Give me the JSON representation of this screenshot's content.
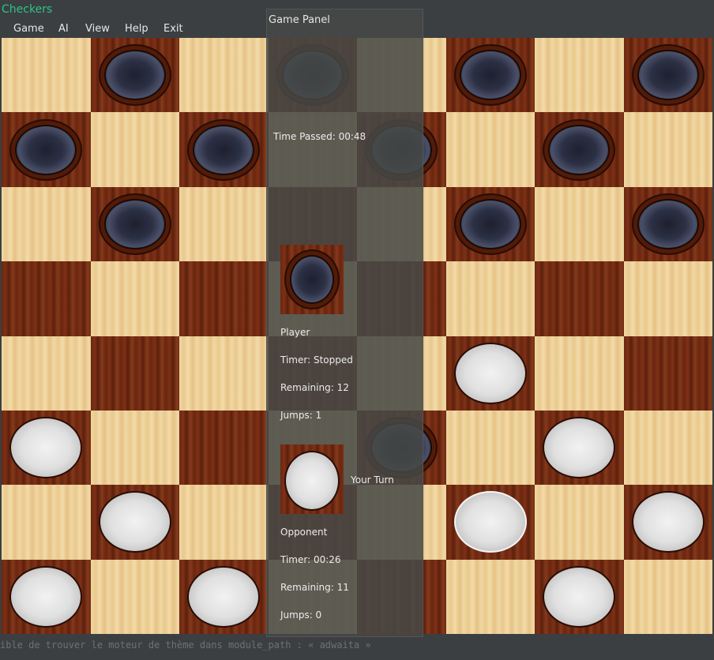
{
  "app": {
    "title": "Checkers"
  },
  "menu": [
    "Game",
    "AI",
    "View",
    "Help",
    "Exit"
  ],
  "board": {
    "rows": 8,
    "cols": 8,
    "pieces": [
      {
        "row": 0,
        "col": 1,
        "color": "black"
      },
      {
        "row": 0,
        "col": 3,
        "color": "black"
      },
      {
        "row": 0,
        "col": 5,
        "color": "black"
      },
      {
        "row": 0,
        "col": 7,
        "color": "black"
      },
      {
        "row": 1,
        "col": 0,
        "color": "black"
      },
      {
        "row": 1,
        "col": 2,
        "color": "black"
      },
      {
        "row": 1,
        "col": 4,
        "color": "black"
      },
      {
        "row": 1,
        "col": 6,
        "color": "black"
      },
      {
        "row": 2,
        "col": 1,
        "color": "black"
      },
      {
        "row": 2,
        "col": 5,
        "color": "black"
      },
      {
        "row": 2,
        "col": 7,
        "color": "black"
      },
      {
        "row": 4,
        "col": 5,
        "color": "white"
      },
      {
        "row": 5,
        "col": 0,
        "color": "white"
      },
      {
        "row": 5,
        "col": 4,
        "color": "black"
      },
      {
        "row": 5,
        "col": 6,
        "color": "white"
      },
      {
        "row": 6,
        "col": 1,
        "color": "white"
      },
      {
        "row": 6,
        "col": 5,
        "color": "white",
        "selected": true
      },
      {
        "row": 6,
        "col": 7,
        "color": "white"
      },
      {
        "row": 7,
        "col": 0,
        "color": "white"
      },
      {
        "row": 7,
        "col": 2,
        "color": "white"
      },
      {
        "row": 7,
        "col": 6,
        "color": "white"
      }
    ]
  },
  "panel": {
    "title": "Game Panel",
    "time_passed": "Time Passed: 00:48",
    "player": {
      "label": "Player",
      "timer": "Timer: Stopped",
      "remaining": "Remaining: 12",
      "jumps": "Jumps: 1",
      "piece_color": "black"
    },
    "turn": "Your Turn",
    "opponent": {
      "label": "Opponent",
      "timer": "Timer: 00:26",
      "remaining": "Remaining: 11",
      "jumps": "Jumps: 0",
      "piece_color": "white"
    }
  },
  "status_text": "ible de trouver le moteur de thème dans module_path : « adwaita »",
  "colors": {
    "title": "#2ec28a",
    "panel_bg": "#464846"
  }
}
